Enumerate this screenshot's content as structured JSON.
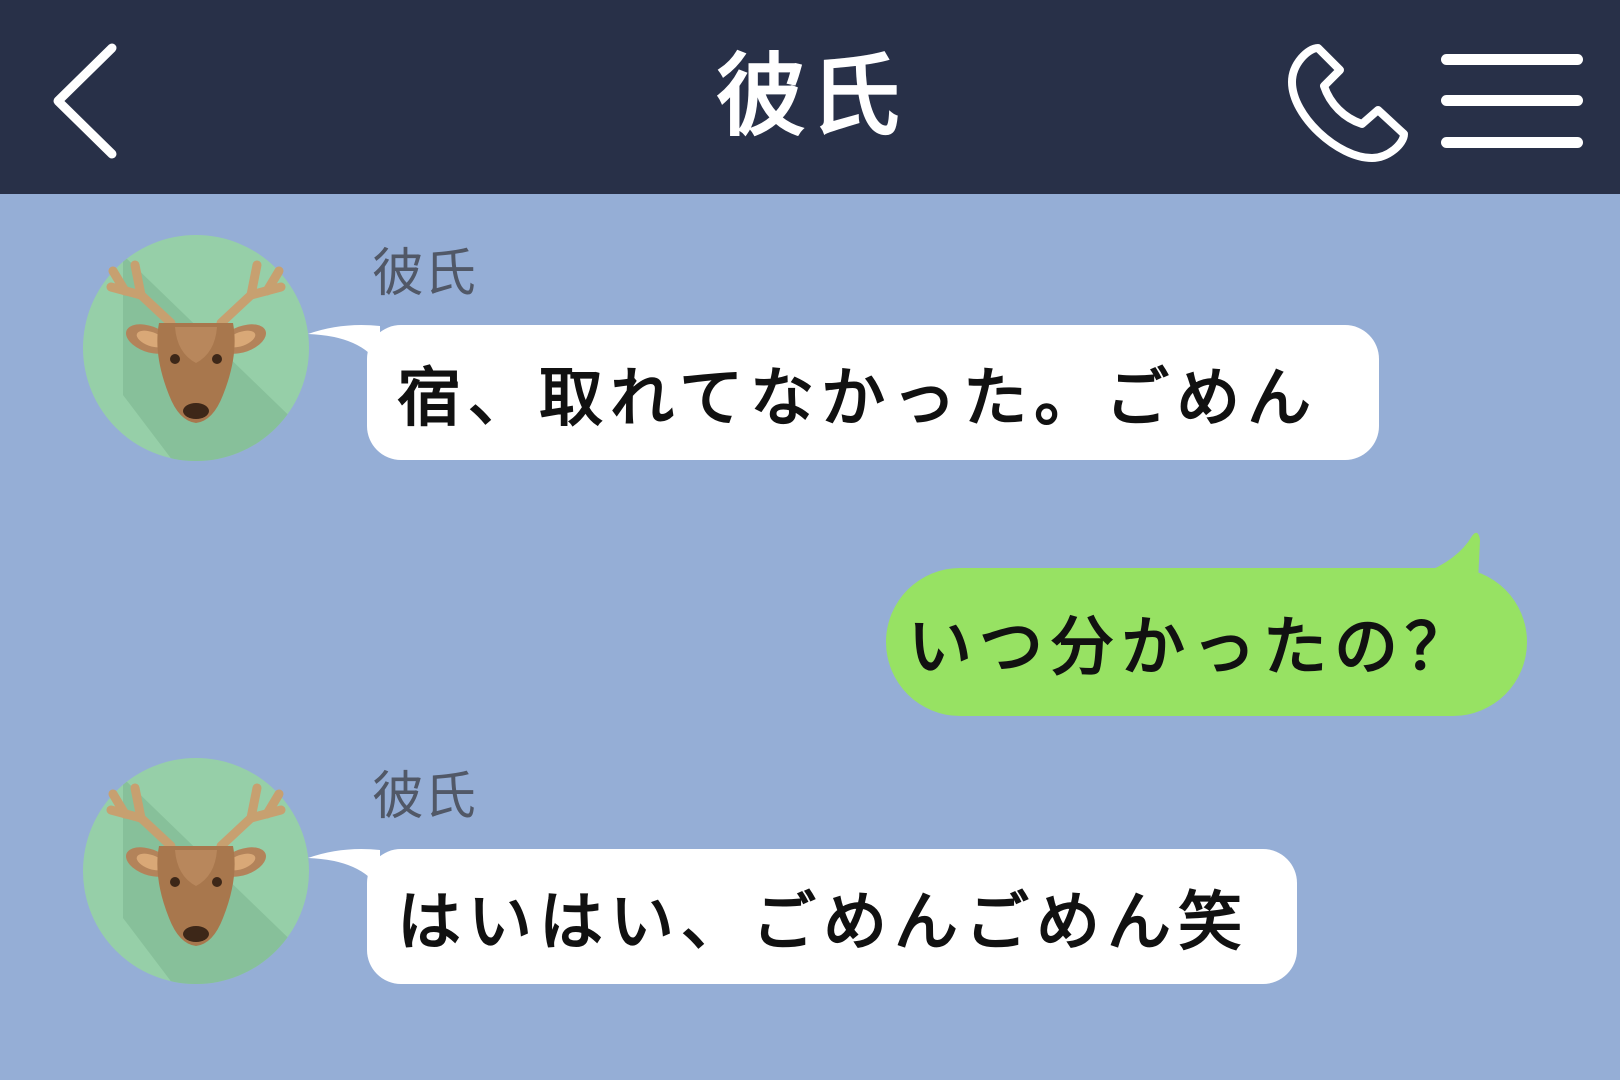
{
  "header": {
    "title": "彼氏",
    "back_icon": "chevron-left-icon",
    "call_icon": "phone-icon",
    "menu_icon": "hamburger-menu-icon"
  },
  "colors": {
    "header_bg": "#283048",
    "chat_bg": "#95aed6",
    "incoming_bubble": "#ffffff",
    "outgoing_bubble": "#97e263",
    "sender_name": "#515867"
  },
  "messages": [
    {
      "side": "left",
      "sender": "彼氏",
      "avatar_icon": "deer-icon",
      "text": "宿、取れてなかった。ごめん"
    },
    {
      "side": "right",
      "text": "いつ分かったの？"
    },
    {
      "side": "left",
      "sender": "彼氏",
      "avatar_icon": "deer-icon",
      "text": "はいはい、ごめんごめん笑"
    }
  ]
}
